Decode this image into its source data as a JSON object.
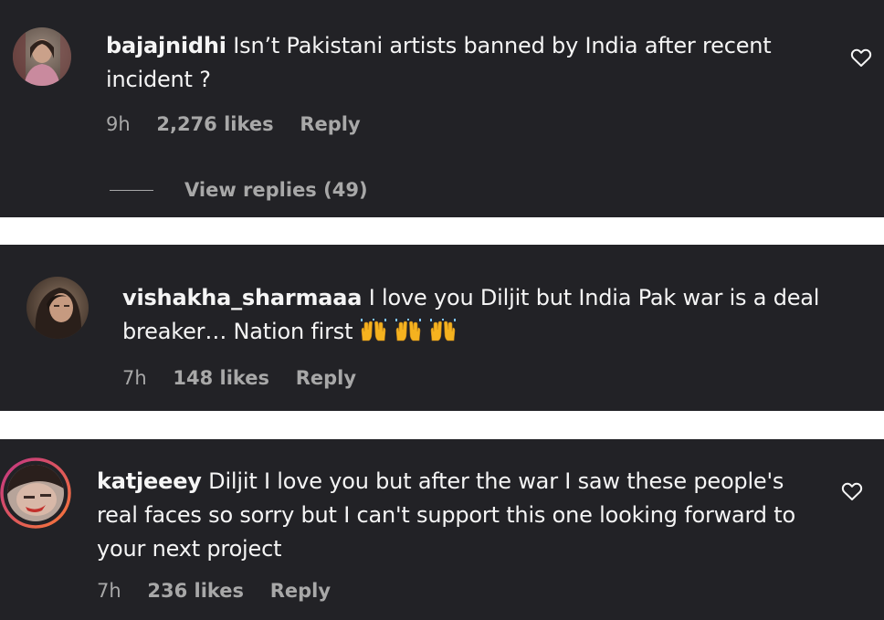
{
  "comments": [
    {
      "username": "bajajnidhi",
      "text": "Isn’t Pakistani artists banned by India after recent incident ?",
      "time": "9h",
      "likes": "2,276 likes",
      "reply_label": "Reply",
      "view_replies": "View replies (49)",
      "icon": "heart-outline-icon"
    },
    {
      "username": "vishakha_sharmaaa",
      "text": "I love you Diljit but India Pak war is a deal breaker… Nation first",
      "emoji": [
        "raising-hands-emoji",
        "raising-hands-emoji",
        "raising-hands-emoji"
      ],
      "time": "7h",
      "likes": "148 likes",
      "reply_label": "Reply"
    },
    {
      "username": "katjeeey",
      "text": "Diljit I love you but after the war I saw these people's real faces so sorry but I can't support this one looking forward to your next project",
      "time": "7h",
      "likes": "236 likes",
      "reply_label": "Reply",
      "icon": "heart-outline-icon"
    }
  ],
  "colors": {
    "card_bg": "#222226",
    "text": "#f5f5f5",
    "secondary": "#a8a8a8",
    "story_ring_start": "#c13584",
    "story_ring_end": "#f77737"
  }
}
